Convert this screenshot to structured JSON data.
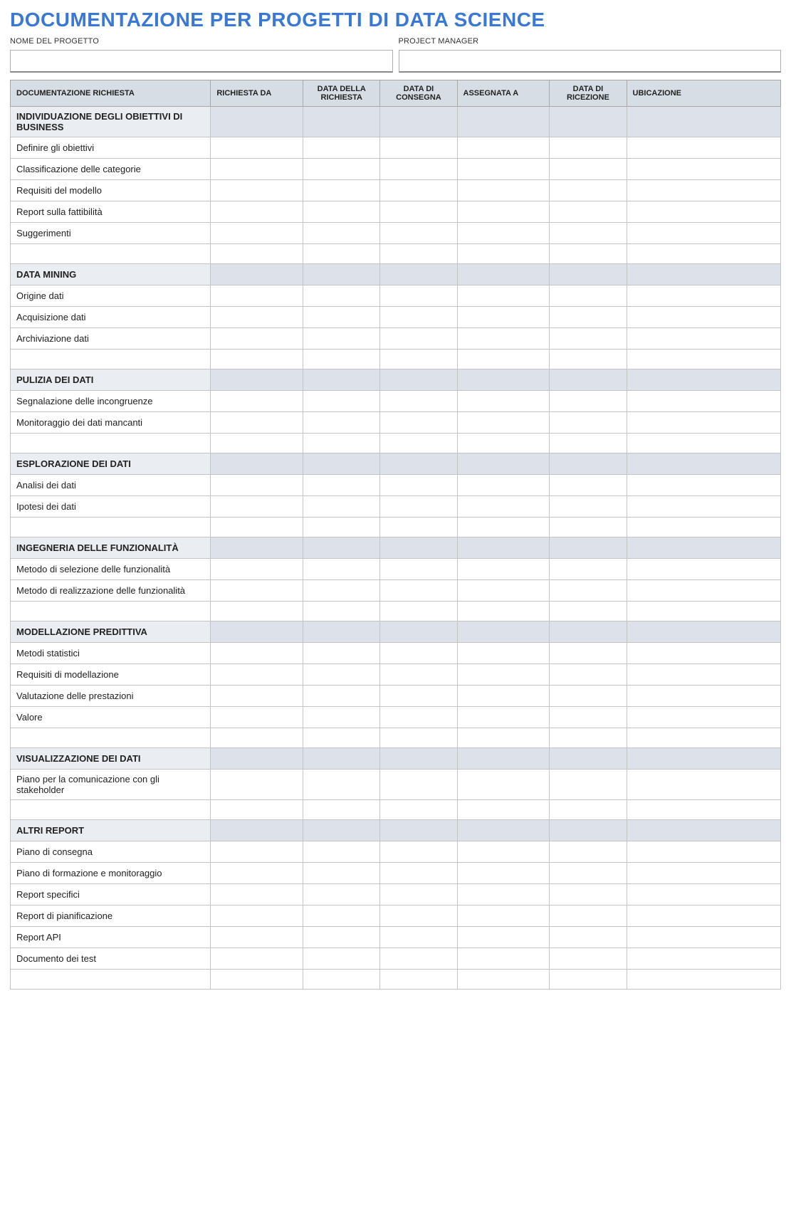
{
  "title": "DOCUMENTAZIONE PER PROGETTI DI DATA SCIENCE",
  "meta": {
    "project_label": "NOME DEL PROGETTO",
    "manager_label": "PROJECT MANAGER",
    "project_value": "",
    "manager_value": ""
  },
  "columns": {
    "doc": "DOCUMENTAZIONE RICHIESTA",
    "req_by": "RICHIESTA DA",
    "req_date": "DATA DELLA RICHIESTA",
    "due_date": "DATA DI CONSEGNA",
    "assigned": "ASSEGNATA A",
    "rec_date": "DATA DI RICEZIONE",
    "location": "UBICAZIONE"
  },
  "sections": [
    {
      "title": "INDIVIDUAZIONE DEGLI OBIETTIVI DI BUSINESS",
      "items": [
        "Definire gli obiettivi",
        "Classificazione delle categorie",
        "Requisiti del modello",
        "Report sulla fattibilità",
        "Suggerimenti"
      ]
    },
    {
      "title": "DATA MINING",
      "items": [
        "Origine dati",
        "Acquisizione dati",
        "Archiviazione dati"
      ]
    },
    {
      "title": "PULIZIA DEI DATI",
      "items": [
        "Segnalazione delle incongruenze",
        "Monitoraggio dei dati mancanti"
      ]
    },
    {
      "title": "ESPLORAZIONE DEI DATI",
      "items": [
        "Analisi dei dati",
        "Ipotesi dei dati"
      ]
    },
    {
      "title": "INGEGNERIA DELLE FUNZIONALITÀ",
      "items": [
        "Metodo di selezione delle funzionalità",
        "Metodo di realizzazione delle funzionalità"
      ]
    },
    {
      "title": "MODELLAZIONE PREDITTIVA",
      "items": [
        "Metodi statistici",
        "Requisiti di modellazione",
        "Valutazione delle prestazioni",
        "Valore"
      ]
    },
    {
      "title": "VISUALIZZAZIONE DEI DATI",
      "items": [
        "Piano per la comunicazione con gli stakeholder"
      ]
    },
    {
      "title": "ALTRI REPORT",
      "items": [
        "Piano di consegna",
        "Piano di formazione e monitoraggio",
        "Report specifici",
        "Report di pianificazione",
        "Report API",
        "Documento dei test"
      ]
    }
  ]
}
